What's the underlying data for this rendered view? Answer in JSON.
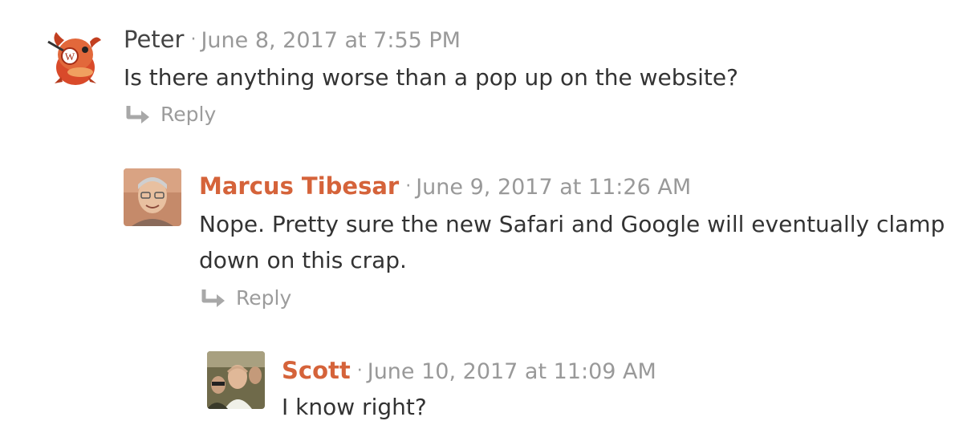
{
  "comments": [
    {
      "author": "Peter",
      "separator": "·",
      "date": "June 8, 2017 at 7:55 PM",
      "text": "Is there anything worse than a pop up on the website?",
      "reply_label": "Reply",
      "avatar_icon": "wapuu-mascot-icon"
    },
    {
      "author": "Marcus Tibesar",
      "separator": "·",
      "date": "June 9, 2017 at 11:26 AM",
      "text": "Nope. Pretty sure the new Safari and Google will eventually clamp down on this crap.",
      "reply_label": "Reply",
      "avatar_icon": "user-photo"
    },
    {
      "author": "Scott",
      "separator": "·",
      "date": "June 10, 2017 at 11:09 AM",
      "text": "I know right?",
      "avatar_icon": "user-photo"
    }
  ],
  "colors": {
    "author_link": "#d5633a",
    "meta_gray": "#999999",
    "body_text": "#333333"
  }
}
